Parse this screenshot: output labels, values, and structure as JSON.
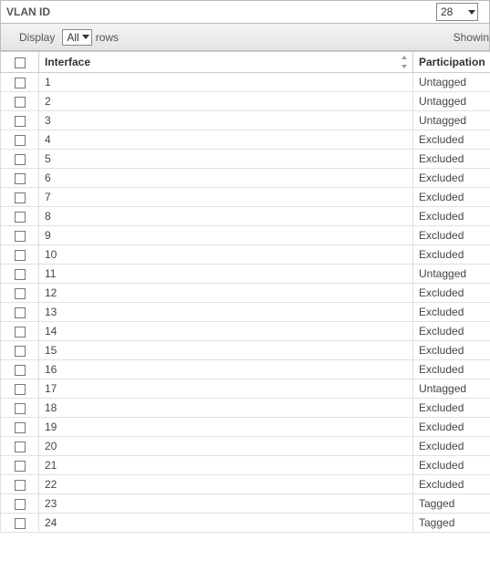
{
  "vlan": {
    "label": "VLAN ID",
    "value": "28"
  },
  "toolbar": {
    "display_label": "Display",
    "display_value": "All",
    "rows_label": "rows",
    "status": "Showin"
  },
  "columns": {
    "interface": "Interface",
    "participation": "Participation"
  },
  "rows": [
    {
      "interface": "1",
      "participation": "Untagged"
    },
    {
      "interface": "2",
      "participation": "Untagged"
    },
    {
      "interface": "3",
      "participation": "Untagged"
    },
    {
      "interface": "4",
      "participation": "Excluded"
    },
    {
      "interface": "5",
      "participation": "Excluded"
    },
    {
      "interface": "6",
      "participation": "Excluded"
    },
    {
      "interface": "7",
      "participation": "Excluded"
    },
    {
      "interface": "8",
      "participation": "Excluded"
    },
    {
      "interface": "9",
      "participation": "Excluded"
    },
    {
      "interface": "10",
      "participation": "Excluded"
    },
    {
      "interface": "11",
      "participation": "Untagged"
    },
    {
      "interface": "12",
      "participation": "Excluded"
    },
    {
      "interface": "13",
      "participation": "Excluded"
    },
    {
      "interface": "14",
      "participation": "Excluded"
    },
    {
      "interface": "15",
      "participation": "Excluded"
    },
    {
      "interface": "16",
      "participation": "Excluded"
    },
    {
      "interface": "17",
      "participation": "Untagged"
    },
    {
      "interface": "18",
      "participation": "Excluded"
    },
    {
      "interface": "19",
      "participation": "Excluded"
    },
    {
      "interface": "20",
      "participation": "Excluded"
    },
    {
      "interface": "21",
      "participation": "Excluded"
    },
    {
      "interface": "22",
      "participation": "Excluded"
    },
    {
      "interface": "23",
      "participation": "Tagged"
    },
    {
      "interface": "24",
      "participation": "Tagged"
    }
  ]
}
